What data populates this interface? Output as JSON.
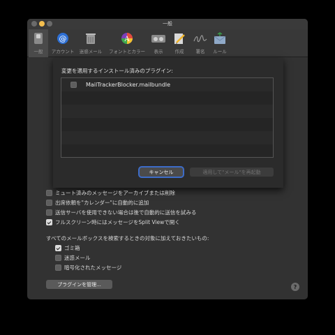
{
  "window": {
    "title": "一般"
  },
  "toolbar": {
    "items": [
      {
        "label": "一般",
        "icon": "switch-icon",
        "active": true
      },
      {
        "label": "アカウント",
        "icon": "at-sign-icon"
      },
      {
        "label": "迷惑メール",
        "icon": "trash-icon"
      },
      {
        "label": "フォントとカラー",
        "icon": "color-palette-icon"
      },
      {
        "label": "表示",
        "icon": "glasses-icon"
      },
      {
        "label": "作成",
        "icon": "pencil-icon"
      },
      {
        "label": "署名",
        "icon": "signature-icon"
      },
      {
        "label": "ルール",
        "icon": "envelope-icon"
      }
    ]
  },
  "sheet": {
    "title": "変更を適用するインストール済みのプラグイン:",
    "plugins": [
      {
        "name": "MailTrackerBlocker.mailbundle",
        "checked": false
      }
    ],
    "cancel_label": "キャンセル",
    "relaunch_label": "適用して\"メール\"を再起動"
  },
  "options": [
    {
      "label": "ミュート済みのメッセージをアーカイブまたは削除",
      "checked": false
    },
    {
      "label": "出席依頼を\"カレンダー\"に自動的に追加",
      "checked": false
    },
    {
      "label": "送信サーバを使用できない場合は後で自動的に送信を試みる",
      "checked": false
    },
    {
      "label": "フルスクリーン時にはメッセージをSplit Viewで開く",
      "checked": true
    }
  ],
  "search": {
    "label": "すべてのメールボックスを検索するときの対象に加えておきたいもの:",
    "items": [
      {
        "label": "ゴミ箱",
        "checked": true
      },
      {
        "label": "迷惑メール",
        "checked": false
      },
      {
        "label": "暗号化されたメッセージ",
        "checked": false
      }
    ]
  },
  "manage_plugins_label": "プラグインを管理...",
  "help_label": "?"
}
